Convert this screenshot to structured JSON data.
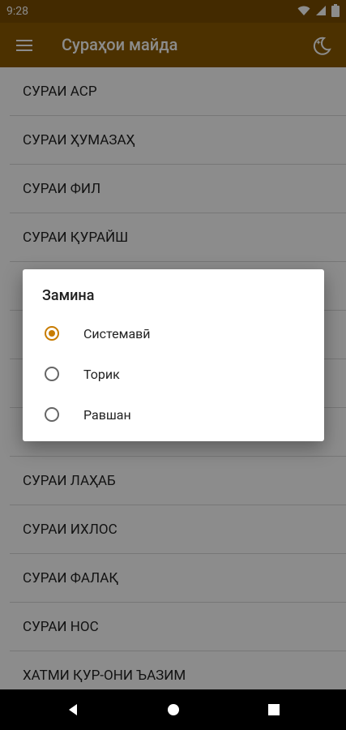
{
  "status_bar": {
    "time": "9:28",
    "icons": [
      "wifi-icon",
      "signal-icon",
      "battery-icon"
    ]
  },
  "app_bar": {
    "title": "Сураҳои майда",
    "menu_icon": "menu-icon",
    "night_icon": "moon-star-icon"
  },
  "list": {
    "items": [
      "СУРАИ АСР",
      "СУРАИ ҲУМАЗАҲ",
      "СУРАИ ФИЛ",
      "СУРАИ ҚУРАЙШ",
      "",
      "",
      "",
      "",
      "СУРАИ ЛАҲАБ",
      "СУРАИ ИХЛОС",
      "СУРАИ ФАЛАҚ",
      "СУРАИ НОС",
      "ХАТМИ ҚУР-ОНИ ЪАЗИМ"
    ]
  },
  "dialog": {
    "title": "Замина",
    "options": [
      {
        "label": "Системавӣ",
        "selected": true
      },
      {
        "label": "Торик",
        "selected": false
      },
      {
        "label": "Равшан",
        "selected": false
      }
    ]
  },
  "nav_bar": {
    "buttons": [
      "back-icon",
      "home-icon",
      "recents-icon"
    ]
  },
  "colors": {
    "app_bar": "#8b5a00",
    "accent": "#c87c00"
  }
}
